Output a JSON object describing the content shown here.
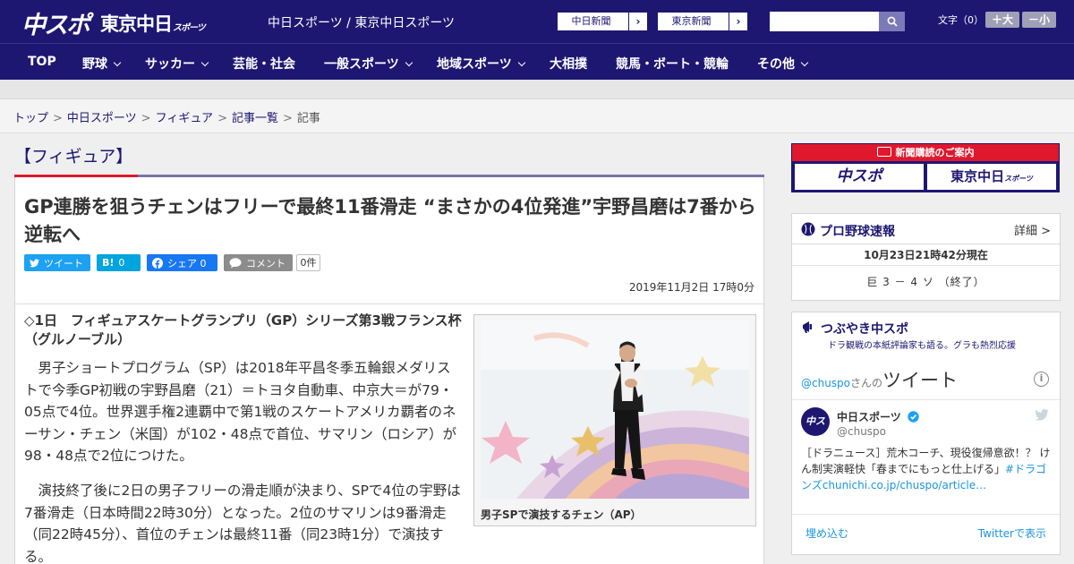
{
  "header": {
    "logo_main": "中スポ",
    "logo_tokyo": "東京中日",
    "logo_tokyo_small": "スポーツ",
    "site_links": "中日スポーツ / 東京中日スポーツ",
    "paper_links": [
      "中日新聞",
      "東京新聞"
    ],
    "search_placeholder": "",
    "font_size_label": "文字（0）",
    "font_larger": "＋大",
    "font_smaller": "－小"
  },
  "nav": {
    "items": [
      {
        "label": "TOP",
        "dropdown": false
      },
      {
        "label": "野球",
        "dropdown": true
      },
      {
        "label": "サッカー",
        "dropdown": true
      },
      {
        "label": "芸能・社会",
        "dropdown": false
      },
      {
        "label": "一般スポーツ",
        "dropdown": true
      },
      {
        "label": "地域スポーツ",
        "dropdown": true
      },
      {
        "label": "大相撲",
        "dropdown": false
      },
      {
        "label": "競馬・ボート・競輪",
        "dropdown": false
      },
      {
        "label": "その他",
        "dropdown": true
      }
    ]
  },
  "breadcrumb": {
    "items": [
      "トップ",
      "中日スポーツ",
      "フィギュア",
      "記事一覧"
    ],
    "current": "記事",
    "separator": ">"
  },
  "article": {
    "category": "【フィギュア】",
    "headline": "GP連勝を狙うチェンはフリーで最終11番滑走 “まさかの4位発進”宇野昌磨は7番から逆転へ",
    "share": {
      "tweet": "ツイート",
      "hatena_count": "0",
      "facebook": "シェア 0",
      "comment": "コメント",
      "comment_count": "0件"
    },
    "date": "2019年11月2日 17時0分",
    "lead": "◇1日　フィギュアスケートグランプリ（GP）シリーズ第3戦フランス杯（グルノーブル）",
    "paragraphs": [
      "男子ショートプログラム（SP）は2018年平昌冬季五輪銀メダリストで今季GP初戦の宇野昌磨（21）＝トヨタ自動車、中京大＝が79・05点で4位。世界選手権2連覇中で第1戦のスケートアメリカ覇者のネーサン・チェン（米国）が102・48点で首位、サマリン（ロシア）が98・48点で2位につけた。",
      "演技終了後に2日の男子フリーの滑走順が決まり、SPで4位の宇野は7番滑走（日本時間22時30分）となった。2位のサマリンは9番滑走（同22時45分）、首位のチェンは最終11番（同23時1分）で演技する。"
    ],
    "photo_caption": "男子SPで演技するチェン（AP）"
  },
  "sidebar": {
    "subscribe": {
      "title": "新聞購読のご案内",
      "brand1": "中スポ",
      "brand2": "東京中日",
      "brand2_small": "スポーツ"
    },
    "baseball": {
      "title": "プロ野球速報",
      "detail": "詳細 >",
      "timestamp": "10月23日21時42分現在",
      "score": "巨 3 － 4 ソ （終了）"
    },
    "twitter": {
      "title": "つぶやき中スポ",
      "subtitle": "ドラ観戦の本紙評論家も語る。グラも熱烈応援",
      "handle_link": "@chuspo",
      "handle_suffix": "さんの",
      "tweets_label": "ツイート",
      "account_name": "中日スポーツ",
      "account_handle": "@chuspo",
      "avatar_text": "中スポ",
      "tweet_text": "［ドラニュース］荒木コーチ、現役復帰意欲！？ けん制実演軽快「春までにもっと仕上げる」",
      "tweet_link": "#ドラゴンズchunichi.co.jp/chuspo/article…",
      "embed": "埋め込む",
      "view_on": "Twitterで表示"
    }
  },
  "colors": {
    "brand_navy": "#1d1772",
    "accent_red": "#e0182d",
    "twitter_blue": "#1da1f2",
    "facebook_blue": "#1877f2"
  }
}
